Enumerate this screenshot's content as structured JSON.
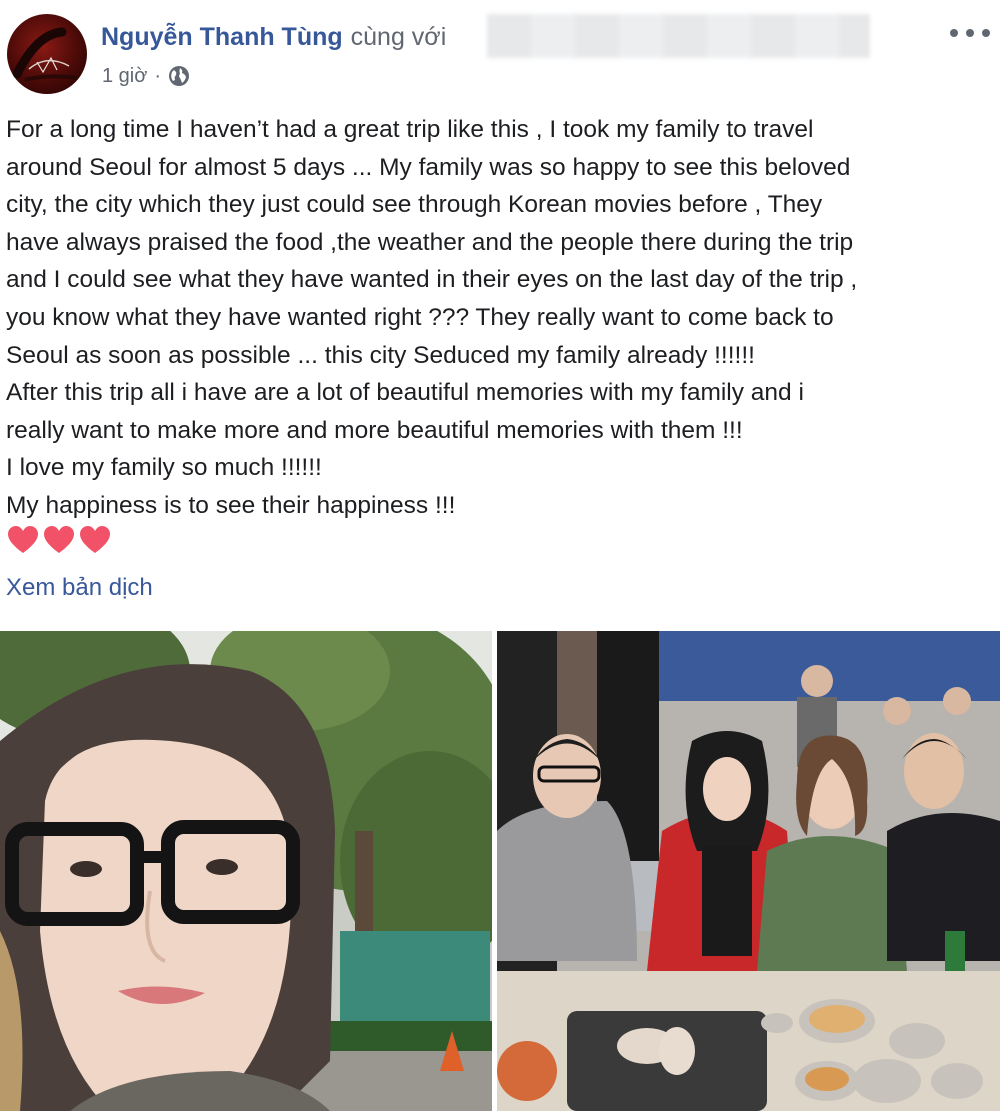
{
  "post": {
    "author": {
      "name": "Nguyễn Thanh Tùng",
      "with_text": "cùng với"
    },
    "meta": {
      "time": "1 giờ",
      "separator": "·",
      "audience_icon": "globe-icon"
    },
    "more_icon": "more-options-icon",
    "body_lines": [
      "For a long time I haven’t had a great trip like this , I took my family to travel",
      "around Seoul for almost 5 days ... My family was so happy to see this beloved",
      "city, the city which they just could see through Korean movies before , They",
      "have always praised the food ,the weather and the people there during the trip",
      "and I could see what they have wanted in their eyes on the last day of the trip ,",
      "you know what they have wanted right ??? They really want to come back to",
      "Seoul as soon as possible ... this city Seduced my family already !!!!!!",
      "After this trip all i have are a lot of beautiful memories with my family and i",
      "really want to make more and more beautiful memories with them !!!",
      "I love my family so much !!!!!!",
      "My happiness is to see their happiness !!!"
    ],
    "hearts": [
      "heart-icon",
      "heart-icon",
      "heart-icon"
    ],
    "see_translation": "Xem bản dịch",
    "photos": [
      "selfie-photo",
      "family-dinner-photo"
    ]
  },
  "colors": {
    "link_blue": "#365899",
    "meta_gray": "#616770",
    "text": "#1c1e21",
    "heart_pink": "#f25268"
  }
}
